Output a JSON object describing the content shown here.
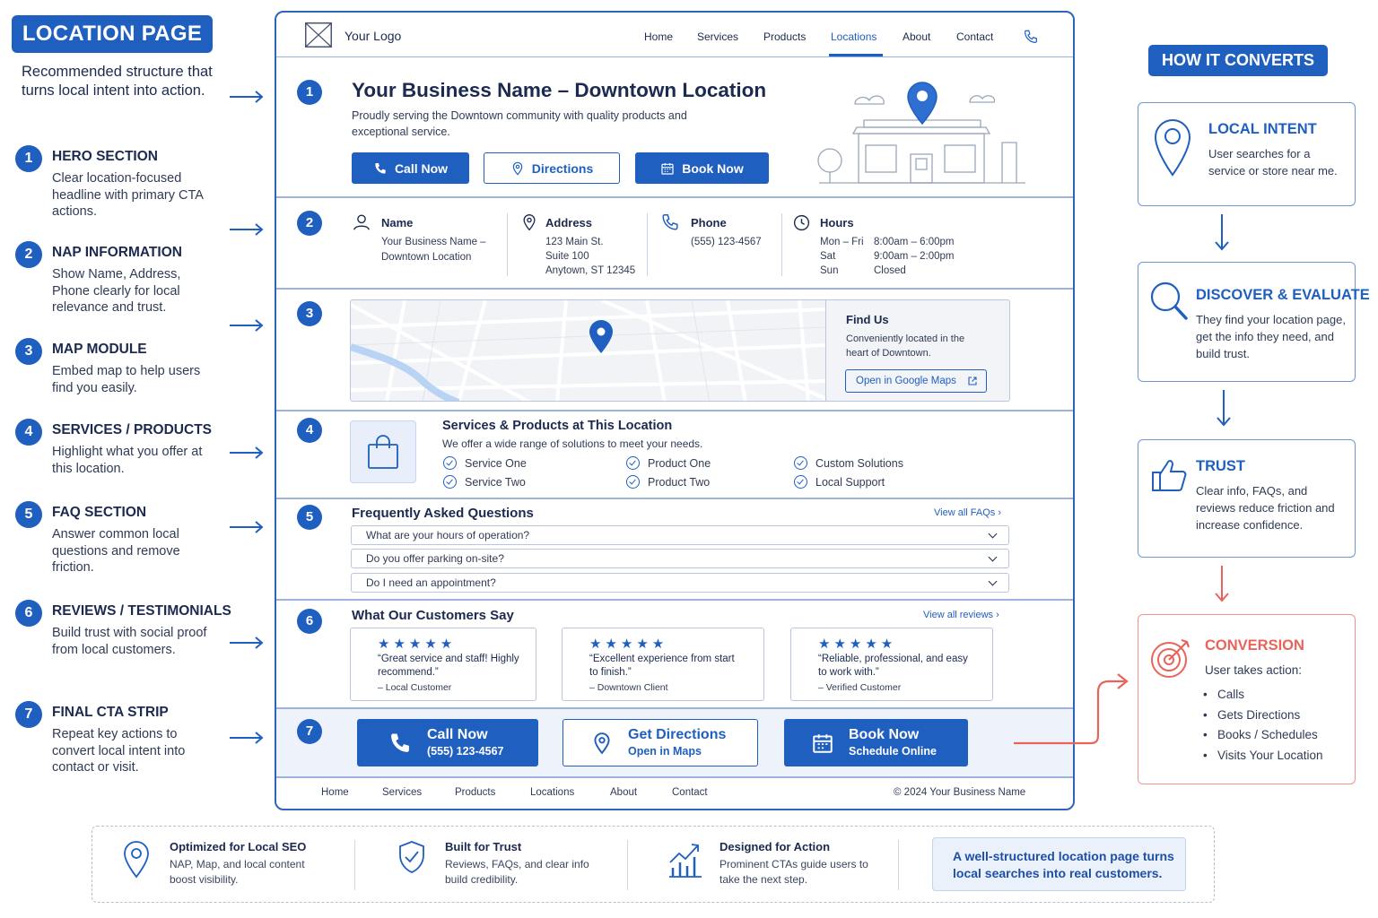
{
  "left": {
    "title": "LOCATION PAGE",
    "intro": "Recommended structure that turns local intent into action.",
    "steps": [
      {
        "num": "1",
        "heading": "HERO SECTION",
        "desc": "Clear location-focused headline with primary CTA actions."
      },
      {
        "num": "2",
        "heading": "NAP INFORMATION",
        "desc": "Show Name, Address, Phone clearly for local relevance and trust."
      },
      {
        "num": "3",
        "heading": "MAP MODULE",
        "desc": "Embed map to help users find you easily."
      },
      {
        "num": "4",
        "heading": "SERVICES / PRODUCTS",
        "desc": "Highlight what you offer at this location."
      },
      {
        "num": "5",
        "heading": "FAQ SECTION",
        "desc": "Answer common local questions and remove friction."
      },
      {
        "num": "6",
        "heading": "REVIEWS / TESTIMONIALS",
        "desc": "Build trust with social proof from local customers."
      },
      {
        "num": "7",
        "heading": "FINAL CTA STRIP",
        "desc": "Repeat key actions to convert local intent into contact or visit."
      }
    ]
  },
  "mock": {
    "logo": "Your Logo",
    "nav": [
      "Home",
      "Services",
      "Products",
      "Locations",
      "About",
      "Contact"
    ],
    "nav_active": "Locations",
    "hero": {
      "num": "1",
      "title": "Your Business Name – Downtown Location",
      "subtitle": "Proudly serving the Downtown community with quality products and exceptional service.",
      "buttons": [
        "Call Now",
        "Directions",
        "Book Now"
      ]
    },
    "nap": {
      "num": "2",
      "name_h": "Name",
      "name_v": "Your Business Name – Downtown Location",
      "addr_h": "Address",
      "addr_1": "123 Main St.",
      "addr_2": "Suite 100",
      "addr_3": "Anytown, ST 12345",
      "phone_h": "Phone",
      "phone_v": "(555) 123-4567",
      "hours_h": "Hours",
      "hours": [
        {
          "day": "Mon – Fri",
          "time": "8:00am – 6:00pm"
        },
        {
          "day": "Sat",
          "time": "9:00am – 2:00pm"
        },
        {
          "day": "Sun",
          "time": "Closed"
        }
      ]
    },
    "map": {
      "num": "3",
      "title": "Find Us",
      "desc": "Conveniently located in the heart of Downtown.",
      "link": "Open in Google Maps"
    },
    "services": {
      "num": "4",
      "title": "Services & Products at This Location",
      "desc": "We offer a wide range of solutions to meet your needs.",
      "items": [
        "Service One",
        "Service Two",
        "Product One",
        "Product Two",
        "Custom Solutions",
        "Local Support"
      ]
    },
    "faq": {
      "num": "5",
      "title": "Frequently Asked Questions",
      "link": "View all FAQs",
      "questions": [
        "What are your hours of operation?",
        "Do you offer parking on-site?",
        "Do I need an appointment?"
      ]
    },
    "reviews": {
      "num": "6",
      "title": "What Our Customers Say",
      "link": "View all reviews",
      "stars": "★★★★★",
      "items": [
        {
          "quote": "“Great service and staff! Highly recommend.”",
          "author": "– Local Customer"
        },
        {
          "quote": "“Excellent experience from start to finish.”",
          "author": "– Downtown Client"
        },
        {
          "quote": "“Reliable, professional, and easy to work with.”",
          "author": "– Verified Customer"
        }
      ]
    },
    "cta": {
      "num": "7",
      "call_l1": "Call Now",
      "call_l2": "(555) 123-4567",
      "dir_l1": "Get Directions",
      "dir_l2": "Open in Maps",
      "book_l1": "Book Now",
      "book_l2": "Schedule Online"
    },
    "footer": {
      "links": [
        "Home",
        "Services",
        "Products",
        "Locations",
        "About",
        "Contact"
      ],
      "copyright": "© 2024 Your Business Name"
    }
  },
  "right": {
    "title": "HOW IT CONVERTS",
    "cards": [
      {
        "heading": "LOCAL INTENT",
        "desc": "User searches for a service or store near me."
      },
      {
        "heading": "DISCOVER & EVALUATE",
        "desc": "They find your location page, get the info they need, and build trust."
      },
      {
        "heading": "TRUST",
        "desc": "Clear info, FAQs, and reviews reduce friction and increase confidence."
      },
      {
        "heading": "CONVERSION",
        "desc": "User takes action:",
        "bullets": [
          "Calls",
          "Gets Directions",
          "Books / Schedules",
          "Visits Your Location"
        ]
      }
    ],
    "colors": {
      "accent": "#1f5fbf",
      "conversion": "#e8645a"
    }
  },
  "bottom": {
    "items": [
      {
        "heading": "Optimized for Local SEO",
        "desc": "NAP, Map, and local content boost visibility."
      },
      {
        "heading": "Built for Trust",
        "desc": "Reviews, FAQs, and clear info build credibility."
      },
      {
        "heading": "Designed for Action",
        "desc": "Prominent CTAs guide users to take the next step."
      }
    ],
    "final": "A well-structured location page turns local searches into real customers."
  }
}
